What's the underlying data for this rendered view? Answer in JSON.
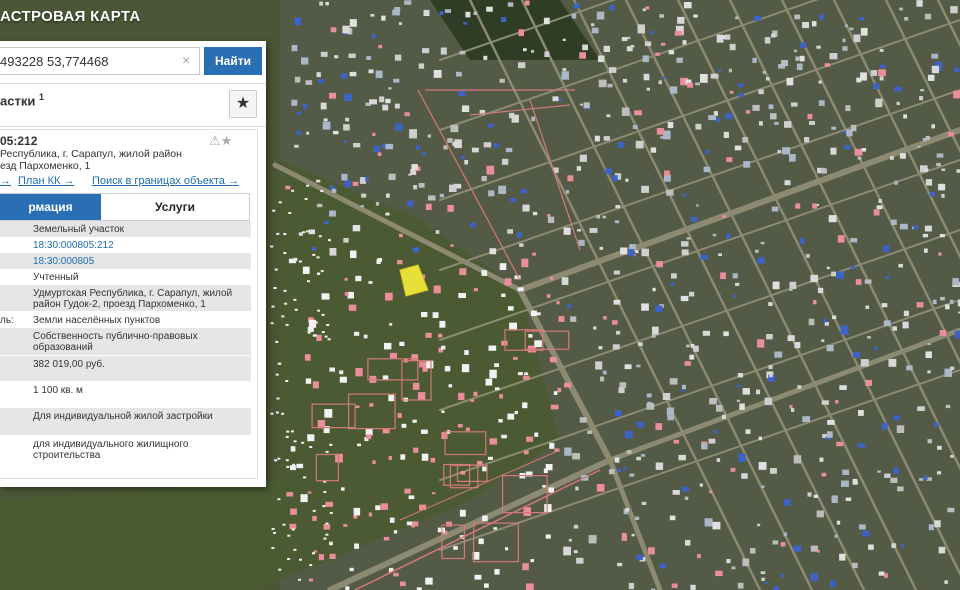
{
  "map": {
    "colors": {
      "ground": "#4b5636",
      "road": "#8d8a72",
      "boundary": "#d47a7a",
      "parcel_highlight": "#e8e03a",
      "roof_red": "#e98e9a",
      "roof_blue": "#3d63c9"
    },
    "marker_icon": "parcel-highlight"
  },
  "header": {
    "title": "АСТРОВАЯ КАРТА"
  },
  "search": {
    "value": "493228 53,774468",
    "clear_icon": "×",
    "button_label": "Найти"
  },
  "section": {
    "title": "астки",
    "count": "1",
    "favorite_icon": "★"
  },
  "card": {
    "number": "05:212",
    "icons": "⚠★",
    "address_lines": [
      "Республика, г. Сарапул, жилой район",
      "езд Пархоменко, 1"
    ],
    "links": [
      "→",
      "План КК →",
      "Поиск в границах объекта →"
    ]
  },
  "tabs": {
    "info": "рмация",
    "services": "Услуги"
  },
  "attributes": [
    {
      "label": "",
      "value": "Земельный участок",
      "link": false
    },
    {
      "label": "",
      "value": "18:30:000805:212",
      "link": true
    },
    {
      "label": "",
      "value": "18:30:000805",
      "link": true
    },
    {
      "label": "",
      "value": "Учтенный",
      "link": false
    },
    {
      "label": "",
      "value": "Удмуртская Республика, г. Сарапул, жилой район Гудок-2, проезд Пархоменко, 1",
      "link": false
    },
    {
      "label": "ль:",
      "value": "Земли населённых пунктов",
      "link": false
    },
    {
      "label": "",
      "value": "Собственность публично-правовых образований",
      "link": false
    },
    {
      "label": "",
      "value": "382 019,00 руб.",
      "link": false
    },
    {
      "label": "",
      "value": "1 100 кв. м",
      "link": false
    },
    {
      "label": "",
      "value": "Для индивидуальной жилой застройки",
      "link": false
    },
    {
      "label": "",
      "value": "для индивидуального жилищного строительства",
      "link": false
    }
  ]
}
